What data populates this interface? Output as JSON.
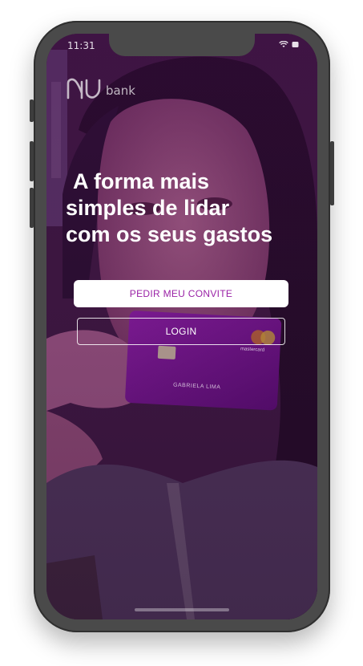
{
  "status_bar": {
    "time": "11:31"
  },
  "brand": {
    "wordmark": "bank",
    "logo_icon": "nu-logo-icon"
  },
  "hero": {
    "headline_lines": [
      "A forma mais",
      "simples de lidar",
      "com os seus gastos"
    ]
  },
  "card": {
    "holder_name": "GABRIELA LIMA",
    "network": "mastercard"
  },
  "actions": {
    "invite_label": "PEDIR MEU CONVITE",
    "login_label": "LOGIN"
  },
  "colors": {
    "brand_purple": "#8a05be",
    "button_text_purple": "#9a22a6",
    "device_frame": "#4a4a4a"
  }
}
